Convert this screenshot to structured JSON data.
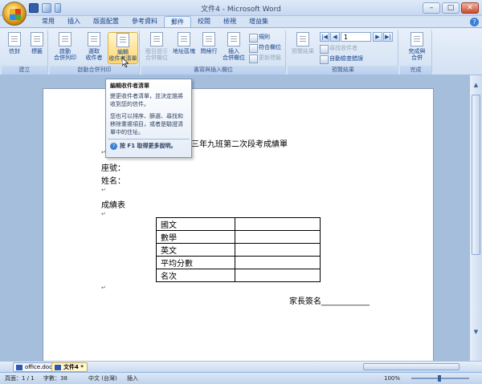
{
  "window": {
    "title": "文件4 - Microsoft Word",
    "controls": {
      "minimize": "–",
      "maximize": "□",
      "close": "✕"
    }
  },
  "tabs": [
    {
      "label": "常用"
    },
    {
      "label": "插入"
    },
    {
      "label": "版面配置"
    },
    {
      "label": "參考資料"
    },
    {
      "label": "郵件"
    },
    {
      "label": "校閱"
    },
    {
      "label": "檢視"
    },
    {
      "label": "增益集"
    }
  ],
  "ribbon": {
    "groups": {
      "create": {
        "label": "建立",
        "envelopes": "信封",
        "labels": "標籤"
      },
      "start_merge": {
        "label": "啟動合併列印",
        "start": [
          "啟動",
          "合併列印"
        ],
        "select": [
          "選取",
          "收件者"
        ],
        "edit": [
          "編輯",
          "收件者清單"
        ]
      },
      "write_insert": {
        "label": "書寫與插入欄位",
        "highlight": [
          "醒目提示",
          "合併欄位"
        ],
        "address_block": "地址區塊",
        "greeting_line": "問候行",
        "insert_field": [
          "插入",
          "合併欄位"
        ],
        "rules": "規則",
        "match_fields": "符合欄位",
        "update_labels": "更新標籤"
      },
      "preview": {
        "label": "預覽結果",
        "preview_results": "預覽結果",
        "record_number": "1",
        "find_recipient": "尋找收件者",
        "auto_check": "自動檢查錯誤"
      },
      "finish": {
        "label": "完成",
        "finish_merge": [
          "完成與",
          "合併"
        ]
      }
    }
  },
  "tooltip": {
    "title": "編輯收件者清單",
    "para1": "變更收件者清單，並決定誰將收到您的信件。",
    "para2": "您也可以排序、篩選、尋找和移除重複項目，或者是驗證清單中的住址。",
    "help": "按 F1 取得更多說明。"
  },
  "document": {
    "heading": "三年九班第二次段考成績單",
    "seat": "座號：",
    "name": "姓名：",
    "grades_label": "成績表",
    "table_rows": [
      "國文",
      "數學",
      "英文",
      "平均分數",
      "名次"
    ],
    "parent_signature": "家長簽名____________"
  },
  "doc_tabs": [
    {
      "label": "office.doc"
    },
    {
      "label": "文件4 *"
    }
  ],
  "status": {
    "page": "頁面：1 / 1",
    "words": "字數：38",
    "language": "中文 (台灣)",
    "mode": "插入",
    "zoom": "100%"
  },
  "colors": {
    "ribbon_text": "#15428b",
    "highlight": "#ffd66b",
    "doc_background": "#a5bedc"
  }
}
